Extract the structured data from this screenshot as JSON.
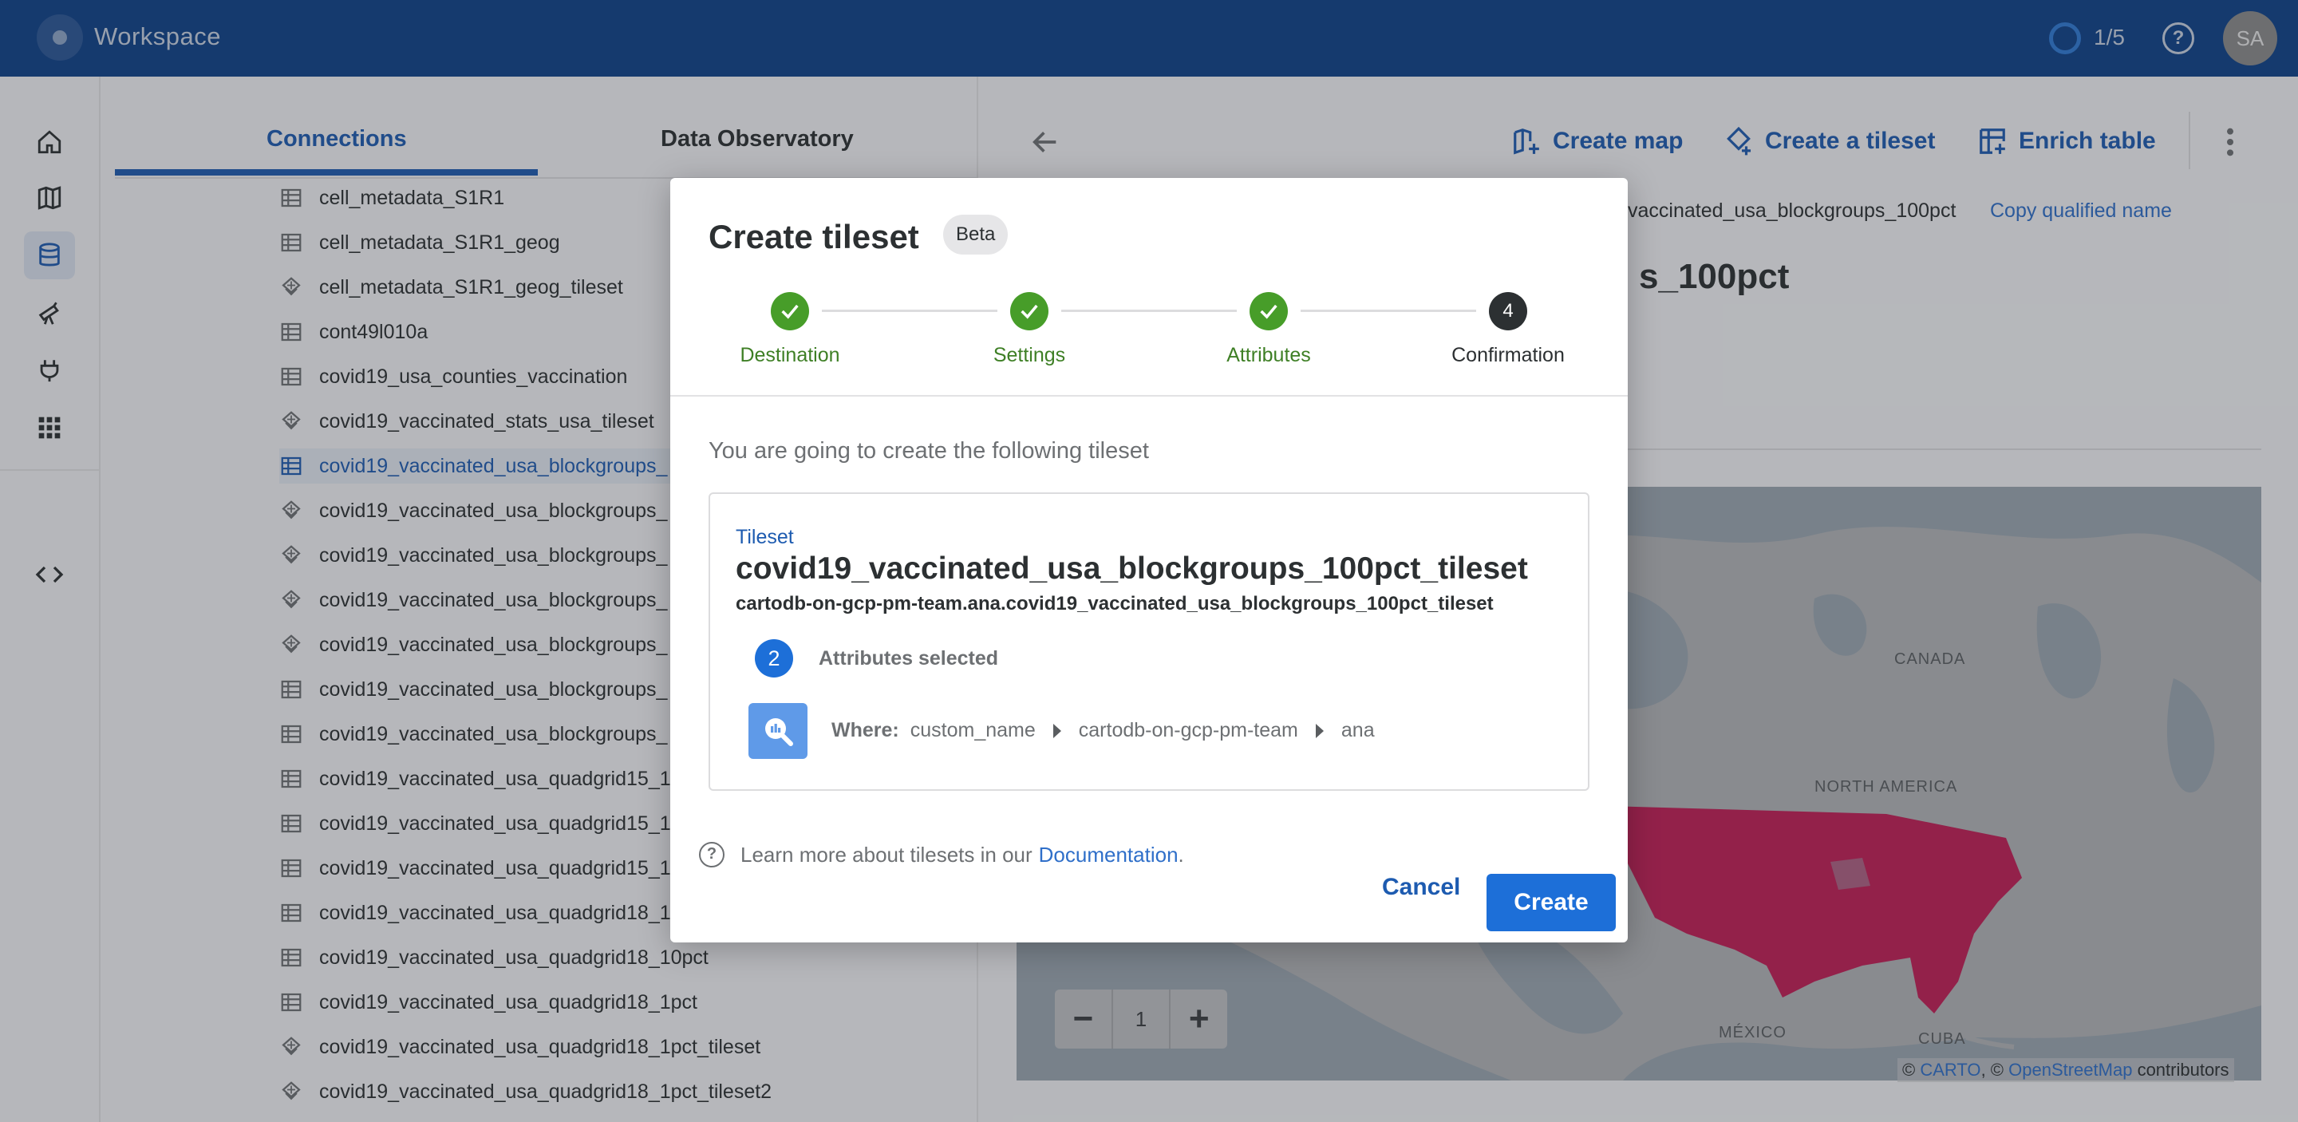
{
  "header": {
    "title": "Workspace",
    "progress": "1/5",
    "help_glyph": "?",
    "avatar_initials": "SA",
    "colors": {
      "background": "#0e4189",
      "progress_ring": "#2f7ad6"
    }
  },
  "rail": {
    "icons": [
      "home-icon",
      "maps-icon",
      "data-explorer-icon",
      "data-observatory-icon",
      "connections-icon",
      "apps-icon",
      "developers-icon"
    ],
    "active": "data-explorer-icon"
  },
  "explorer": {
    "tabs": [
      {
        "label": "Connections",
        "active": true
      },
      {
        "label": "Data Observatory",
        "active": false
      }
    ],
    "items": [
      {
        "name": "cell_metadata_S1R1",
        "type": "table"
      },
      {
        "name": "cell_metadata_S1R1_geog",
        "type": "table"
      },
      {
        "name": "cell_metadata_S1R1_geog_tileset",
        "type": "tileset"
      },
      {
        "name": "cont49l010a",
        "type": "table"
      },
      {
        "name": "covid19_usa_counties_vaccination",
        "type": "table"
      },
      {
        "name": "covid19_vaccinated_stats_usa_tileset",
        "type": "tileset"
      },
      {
        "name": "covid19_vaccinated_usa_blockgroups_",
        "type": "table",
        "selected": true
      },
      {
        "name": "covid19_vaccinated_usa_blockgroups_",
        "type": "tileset"
      },
      {
        "name": "covid19_vaccinated_usa_blockgroups_",
        "type": "tileset"
      },
      {
        "name": "covid19_vaccinated_usa_blockgroups_",
        "type": "tileset"
      },
      {
        "name": "covid19_vaccinated_usa_blockgroups_",
        "type": "tileset"
      },
      {
        "name": "covid19_vaccinated_usa_blockgroups_",
        "type": "table"
      },
      {
        "name": "covid19_vaccinated_usa_blockgroups_",
        "type": "table"
      },
      {
        "name": "covid19_vaccinated_usa_quadgrid15_1",
        "type": "table"
      },
      {
        "name": "covid19_vaccinated_usa_quadgrid15_1",
        "type": "table"
      },
      {
        "name": "covid19_vaccinated_usa_quadgrid15_1",
        "type": "table"
      },
      {
        "name": "covid19_vaccinated_usa_quadgrid18_1",
        "type": "table"
      },
      {
        "name": "covid19_vaccinated_usa_quadgrid18_10pct",
        "type": "table"
      },
      {
        "name": "covid19_vaccinated_usa_quadgrid18_1pct",
        "type": "table"
      },
      {
        "name": "covid19_vaccinated_usa_quadgrid18_1pct_tileset",
        "type": "tileset"
      },
      {
        "name": "covid19_vaccinated_usa_quadgrid18_1pct_tileset2",
        "type": "tileset"
      }
    ]
  },
  "detail": {
    "actions": {
      "create_map": "Create map",
      "create_tileset": "Create a tileset",
      "enrich_table": "Enrich table"
    },
    "qualified_name_visible": "vaccinated_usa_blockgroups_100pct",
    "copy_qualified_name": "Copy qualified name",
    "title_visible": "s_100pct",
    "map": {
      "labels": {
        "canada": "CANADA",
        "north_america": "NORTH AMERICA",
        "mexico": "MÉXICO",
        "cuba": "CUBA"
      },
      "zoom_level": "1",
      "zoom_out": "−",
      "zoom_in": "+",
      "attribution": {
        "prefix": "©",
        "carto": "CARTO",
        "sep": ", ©",
        "osm": "OpenStreetMap",
        "suffix": "contributors"
      },
      "colors": {
        "data": "#c21d55",
        "land": "#b3b5b8",
        "water": "#9ba6b1"
      }
    }
  },
  "dialog": {
    "title": "Create tileset",
    "badge": "Beta",
    "steps": [
      {
        "label": "Destination",
        "state": "done"
      },
      {
        "label": "Settings",
        "state": "done"
      },
      {
        "label": "Attributes",
        "state": "done"
      },
      {
        "label": "Confirmation",
        "state": "current",
        "number": "4"
      }
    ],
    "intro": "You are going to create the following tileset",
    "card": {
      "kind": "Tileset",
      "name": "covid19_vaccinated_usa_blockgroups_100pct_tileset",
      "qualified_name": "cartodb-on-gcp-pm-team.ana.covid19_vaccinated_usa_blockgroups_100pct_tileset",
      "attributes_count": "2",
      "attributes_label": "Attributes selected",
      "where_label": "Where:",
      "path": [
        "custom_name",
        "cartodb-on-gcp-pm-team",
        "ana"
      ]
    },
    "learn_more": "Learn more about tilesets in our",
    "documentation_link": "Documentation",
    "learn_more_end": ".",
    "cancel": "Cancel",
    "create": "Create",
    "colors": {
      "primary": "#1d6fd8",
      "step_done": "#479d29"
    }
  }
}
